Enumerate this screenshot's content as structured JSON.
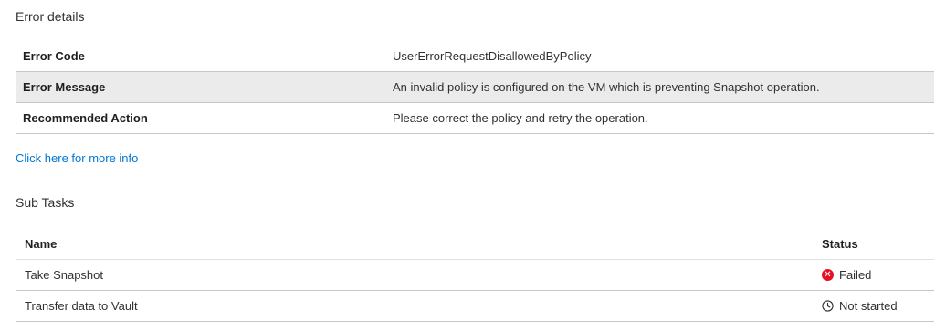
{
  "error_details": {
    "title": "Error details",
    "rows": [
      {
        "label": "Error Code",
        "value": "UserErrorRequestDisallowedByPolicy"
      },
      {
        "label": "Error Message",
        "value": "An invalid policy is configured on the VM which is preventing Snapshot operation."
      },
      {
        "label": "Recommended Action",
        "value": "Please correct the policy and retry the operation."
      }
    ],
    "link_text": "Click here for more info"
  },
  "sub_tasks": {
    "title": "Sub Tasks",
    "columns": {
      "name": "Name",
      "status": "Status"
    },
    "rows": [
      {
        "name": "Take Snapshot",
        "status": "Failed",
        "status_icon": "failed-icon"
      },
      {
        "name": "Transfer data to Vault",
        "status": "Not started",
        "status_icon": "clock-icon"
      }
    ]
  },
  "colors": {
    "link": "#0078d4",
    "failed": "#e81123",
    "shaded_row": "#ebebeb"
  }
}
